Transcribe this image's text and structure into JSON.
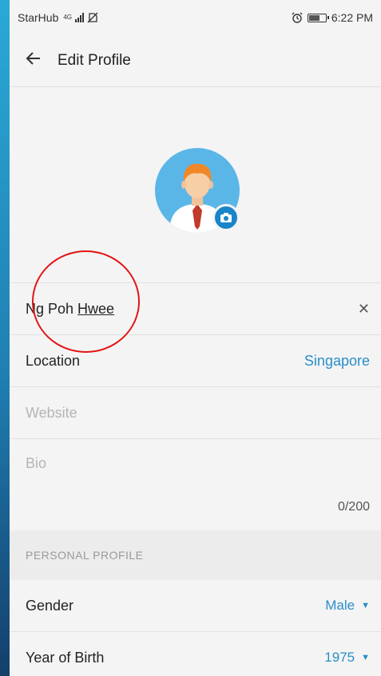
{
  "status": {
    "carrier": "StarHub",
    "network": "4G",
    "time": "6:22 PM",
    "icons": [
      "signal-icon",
      "no-sim-icon",
      "alarm-icon",
      "battery-icon"
    ]
  },
  "header": {
    "title": "Edit Profile",
    "back_icon": "back-arrow-icon"
  },
  "avatar": {
    "icon": "avatar-icon",
    "camera_icon": "camera-icon"
  },
  "fields": {
    "name": {
      "first": "Ng Poh ",
      "highlight": "Hwee",
      "clear_icon": "clear-icon"
    },
    "location": {
      "label": "Location",
      "value": "Singapore"
    },
    "website": {
      "placeholder": "Website"
    },
    "bio": {
      "placeholder": "Bio",
      "counter": "0/200"
    }
  },
  "personal": {
    "section_title": "PERSONAL PROFILE",
    "gender": {
      "label": "Gender",
      "value": "Male"
    },
    "year": {
      "label": "Year of Birth",
      "value": "1975"
    }
  },
  "colors": {
    "accent": "#2a8ec8",
    "annotation": "#e31414",
    "avatar_bg": "#5bb6e8"
  }
}
